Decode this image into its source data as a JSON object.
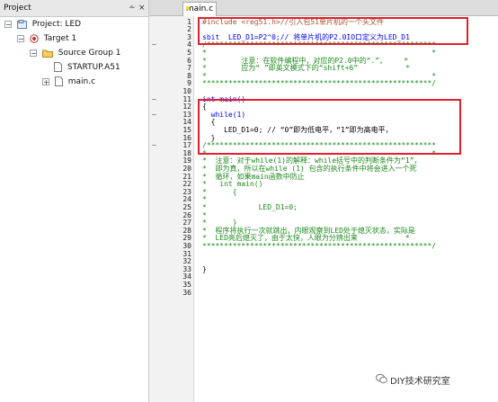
{
  "project_panel": {
    "title": "Project",
    "pin_glyph": "⩪",
    "close_glyph": "×",
    "tree": [
      {
        "label": "Project: LED",
        "toggle": "−",
        "icon": "project-icon"
      },
      {
        "label": "Target 1",
        "toggle": "−",
        "icon": "target-icon"
      },
      {
        "label": "Source Group 1",
        "toggle": "−",
        "icon": "folder-icon"
      },
      {
        "label": "STARTUP.A51",
        "toggle": "",
        "icon": "file-icon"
      },
      {
        "label": "main.c",
        "toggle": "+",
        "icon": "file-icon"
      }
    ]
  },
  "editor": {
    "tab_label": "main.c",
    "line_numbers": [
      "1",
      "2",
      "3",
      "4",
      "5",
      "6",
      "7",
      "8",
      "9",
      "10",
      "11",
      "12",
      "13",
      "14",
      "15",
      "16",
      "17",
      "18",
      "19",
      "20",
      "21",
      "22",
      "23",
      "24",
      "25",
      "26",
      "27",
      "28",
      "29",
      "30",
      "31",
      "32",
      "33",
      "34",
      "35",
      "36"
    ],
    "fold_markers": {
      "4": "−",
      "11": "−",
      "13": "−",
      "17": "−"
    },
    "lines": [
      "#include <reg51.h>//引入包51单片机的一个头文件",
      "",
      "sbit  LED_D1=P2^0;// 将单片机的P2.0IO口定义为LED_D1",
      "/*****************************************************",
      "*                                                    *",
      "*        注意：在软件编程中，对应的P2.0中的“.”，    *",
      "*        应为“ ”即英文模式下的“shift+6”           *",
      "*                                                    *",
      "*****************************************************/",
      "",
      "int main()",
      "{",
      "  while(1)",
      "  {",
      "     LED_D1=0; // “0”即为低电平，“1”即为高电平，",
      "  }",
      "/*****************************************************",
      "*                                                    *",
      "*  注意：对于while(1)的解释：while括号中的判断条件为“1”，",
      "*  即为真，所以在while (1) 包含的执行条件中将会进入一个死",
      "*  循环，如果main函数中防止",
      "*   int main()",
      "*      {",
      "*",
      "*            LED_D1=0;",
      "*",
      "*      }",
      "*  程序将执行一次就跳出，内眼观察到LED处于熄灭状态，实际是",
      "*  LED亮后熄灭了，由于太快，人眼为分辨出来           *",
      "*****************************************************/",
      "",
      "",
      "}",
      "",
      "",
      ""
    ]
  },
  "watermark": {
    "text": "DIY技术研究室",
    "icon": "wechat-icon"
  },
  "colors": {
    "highlight_box": "#e0202e",
    "comment": "#1a8a1a",
    "keyword": "#0000ff"
  }
}
